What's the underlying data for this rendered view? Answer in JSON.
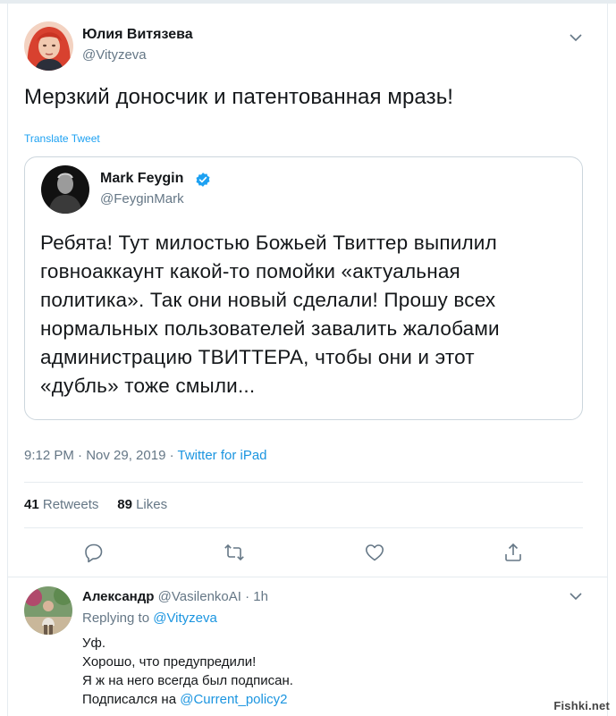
{
  "main_tweet": {
    "author_name": "Юлия Витязева",
    "author_handle": "@Vityzeva",
    "text": "Мерзкий доносчик и патентованная мразь!",
    "translate_label": "Translate Tweet",
    "timestamp": "9:12 PM · Nov 29, 2019 · ",
    "source": "Twitter for iPad",
    "retweets_count": "41",
    "retweets_label": "Retweets",
    "likes_count": "89",
    "likes_label": "Likes"
  },
  "quoted_tweet": {
    "author_name": "Mark Feygin",
    "author_handle": "@FeyginMark",
    "text_lines": [
      "Ребята! Тут милостью Божьей Твиттер выпилил",
      "говноаккаунт какой-то помойки «актуальная",
      "политика». Так они новый сделали! Прошу всех",
      "нормальных пользователей завалить жалобами",
      "администрацию ТВИТТЕРА, чтобы они и этот",
      "«дубль» тоже смыли..."
    ]
  },
  "reply": {
    "author_name": "Александр",
    "author_handle": "@VasilenkoAI",
    "time": "1h",
    "replying_label": "Replying to",
    "replying_to": "@Vityzeva",
    "text_lines": [
      "Уф.",
      "Хорошо, что предупредили!",
      "Я ж на него всегда был подписан."
    ],
    "last_line_prefix": "Подписался на",
    "mention": "@Current_policy2"
  },
  "actions": [
    "reply-icon",
    "retweet-icon",
    "like-icon",
    "share-icon"
  ],
  "watermark": "Fishki.net",
  "colors": {
    "link": "#1b95e0",
    "verified": "#1da1f2",
    "secondary": "#657786",
    "border": "#e6ecf0"
  }
}
